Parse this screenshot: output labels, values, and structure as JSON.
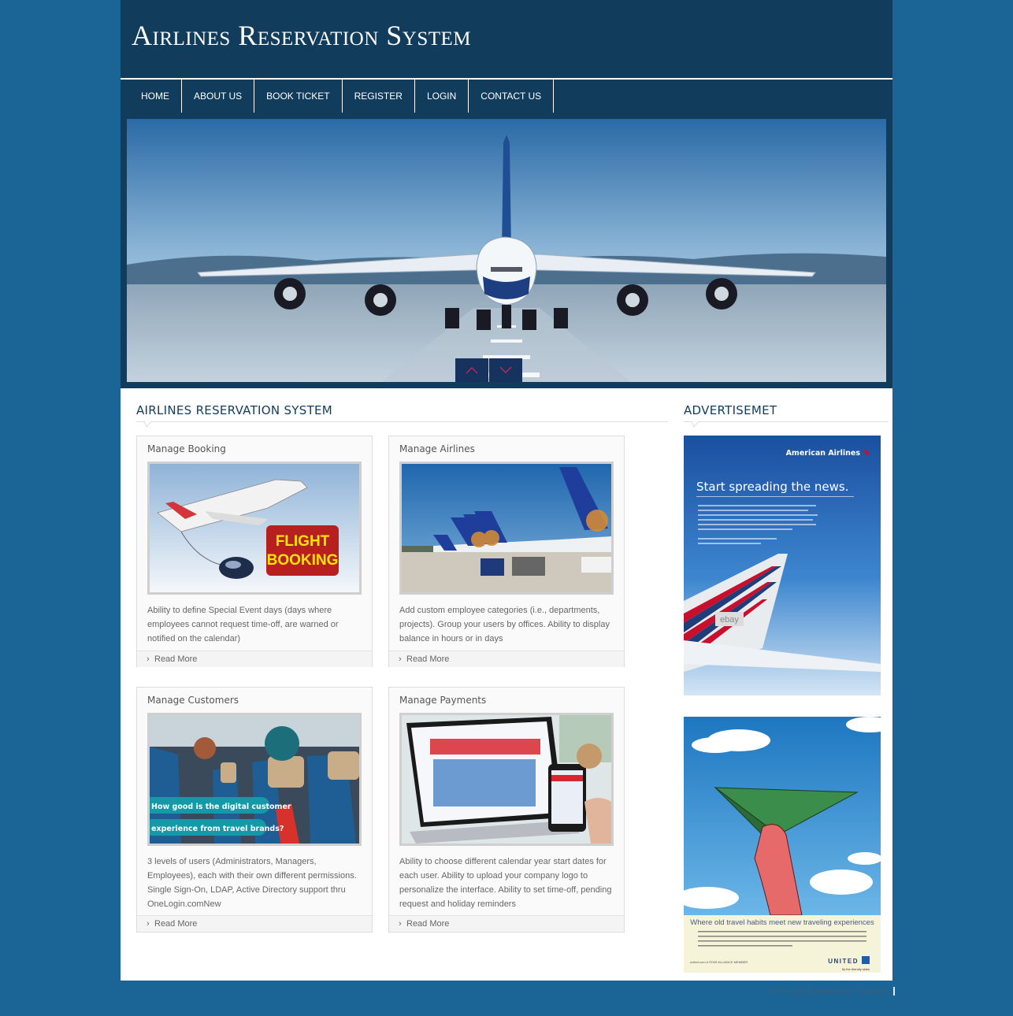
{
  "header": {
    "title": "Airlines Reservation System"
  },
  "nav": {
    "items": [
      {
        "label": "HOME"
      },
      {
        "label": "ABOUT US"
      },
      {
        "label": "BOOK TICKET"
      },
      {
        "label": "REGISTER"
      },
      {
        "label": "LOGIN"
      },
      {
        "label": "CONTACT US"
      }
    ]
  },
  "slider": {
    "image": "airplane-on-runway",
    "prev_icon": "chevron-up-icon",
    "next_icon": "chevron-down-icon"
  },
  "main": {
    "heading": "AIRLINES RESERVATION SYSTEM",
    "cards": [
      {
        "title": "Manage Booking",
        "image": "flight-booking",
        "image_text": [
          "FLIGHT",
          "BOOKING"
        ],
        "text": "Ability to define Special Event days (days where employees cannot request time-off, are warned or notified on the calendar)",
        "link": "Read More"
      },
      {
        "title": "Manage Airlines",
        "image": "airline-tails-at-gate",
        "text": "Add custom employee categories (i.e., departments, projects). Group your users by offices. Ability to display balance in hours or in days",
        "link": "Read More"
      },
      {
        "title": "Manage Customers",
        "image": "aircraft-cabin-passengers",
        "image_text": [
          "How good is the digital customer",
          "experience from travel brands?"
        ],
        "text": "3 levels of users (Administrators, Managers, Employees), each with their own different permissions. Single Sign-On, LDAP, Active Directory support thru OneLogin.comNew",
        "link": "Read More"
      },
      {
        "title": "Manage Payments",
        "image": "laptop-and-phone-booking",
        "text": "Ability to choose different calendar year start dates for each user. Ability to upload your company logo to personalize the interface. Ability to set time-off, pending request and holiday reminders",
        "link": "Read More"
      }
    ]
  },
  "sidebar": {
    "heading": "ADVERTISEMET",
    "ads": [
      {
        "brand": "American Airlines",
        "headline": "Start spreading the news.",
        "tail_logo": "ebay"
      },
      {
        "brand": "UNITED",
        "headline": "Where old travel habits meet new traveling experiences",
        "tagline": "fly the friendly skies",
        "footer": "united.com  A STAR ALLIANCE MEMBER"
      }
    ]
  },
  "footer": {
    "copyright": "© Airlines Reservation System",
    "separator": "|"
  },
  "colors": {
    "page_bg": "#1a6496",
    "header_bg": "#123c5c",
    "content_bg": "#ffffff",
    "heading": "#123c5c",
    "slider_button": "#16325f",
    "slider_arrow": "#e0245e"
  }
}
